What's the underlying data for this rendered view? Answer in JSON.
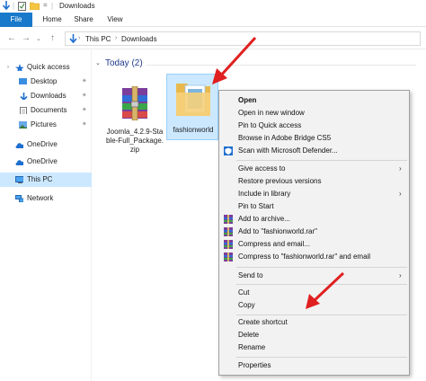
{
  "window": {
    "title": "Downloads"
  },
  "ribbon": {
    "tabs": [
      "File",
      "Home",
      "Share",
      "View"
    ]
  },
  "address": {
    "crumbs": [
      "This PC",
      "Downloads"
    ]
  },
  "sidebar": {
    "items": [
      {
        "label": "Quick access"
      },
      {
        "label": "Desktop"
      },
      {
        "label": "Downloads"
      },
      {
        "label": "Documents"
      },
      {
        "label": "Pictures"
      },
      {
        "label": "OneDrive"
      },
      {
        "label": "OneDrive"
      },
      {
        "label": "This PC"
      },
      {
        "label": "Network"
      }
    ]
  },
  "main": {
    "group_header": "Today (2)",
    "files": [
      {
        "name": "Joomla_4.2.9-Stable-Full_Package.zip",
        "lines": [
          "Joomla_4.2.9-Sta",
          "ble-Full_Package.",
          "zip"
        ]
      },
      {
        "name": "fashionworld"
      }
    ]
  },
  "context_menu": {
    "items": [
      {
        "label": "Open"
      },
      {
        "label": "Open in new window"
      },
      {
        "label": "Pin to Quick access"
      },
      {
        "label": "Browse in Adobe Bridge CS5"
      },
      {
        "label": "Scan with Microsoft Defender..."
      },
      {
        "label": "Give access to"
      },
      {
        "label": "Restore previous versions"
      },
      {
        "label": "Include in library"
      },
      {
        "label": "Pin to Start"
      },
      {
        "label": "Add to archive..."
      },
      {
        "label": "Add to \"fashionworld.rar\""
      },
      {
        "label": "Compress and email..."
      },
      {
        "label": "Compress to \"fashionworld.rar\" and email"
      },
      {
        "label": "Send to"
      },
      {
        "label": "Cut"
      },
      {
        "label": "Copy"
      },
      {
        "label": "Create shortcut"
      },
      {
        "label": "Delete"
      },
      {
        "label": "Rename"
      },
      {
        "label": "Properties"
      }
    ]
  },
  "colors": {
    "accent": "#1979ca",
    "selection": "#cce8ff",
    "annotation": "#e02020"
  }
}
